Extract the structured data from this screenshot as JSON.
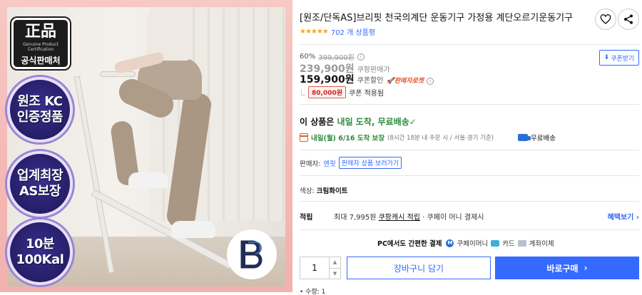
{
  "image": {
    "badge_authentic": {
      "main": "正品",
      "sub_en": "Genuine Product Certification",
      "sub_ko": "공식판매처"
    },
    "seals": [
      {
        "line1": "원조 KC",
        "line2": "인증정품"
      },
      {
        "line1": "업계최장",
        "line2": "AS보장"
      },
      {
        "line1": "10분",
        "line2": "100Kal"
      }
    ],
    "brand_logo_icon": "bb-monogram-icon"
  },
  "product": {
    "title": "[원조/단독AS]브리핏 천국의계단 운동기구 가정용 계단오르기운동기구",
    "stars_display": "★★★★★",
    "rating": 5,
    "review_count": "702 개 상품평"
  },
  "pricing": {
    "discount_rate": "60%",
    "original_price": "399,900원",
    "sale_price": "239,900원",
    "sale_label": "쿠팡판매가",
    "coupon_price": "159,900원",
    "coupon_label": "쿠폰할인",
    "rocket_label": "판매자로켓",
    "coupon_amount": "80,000원",
    "coupon_applied_text": "쿠폰 적용됨",
    "coupon_download_label": "쿠폰받기"
  },
  "delivery": {
    "headline_prefix": "이 상품은 ",
    "headline_highlight": "내일 도착, 무료배송",
    "headline_check": "✓",
    "arrival_date": "내일(월) 6/16 도착 보장",
    "arrival_condition": "(8시간 18분 내 주문 시 / 서울⋅경기 기준)",
    "shipping_fee": "무료배송"
  },
  "seller": {
    "label": "판매자:",
    "name": "엔핏",
    "link_label": "판매자 상품 보러가기"
  },
  "option": {
    "label": "색상:",
    "value": "크림화이트"
  },
  "reward": {
    "label": "적립",
    "max_amount": "최대 7,995원",
    "cash_label": "쿠팡캐시 적립",
    "tail": "· 쿠페이 머니 결제시",
    "benefit_link": "혜택보기"
  },
  "payment": {
    "lead": "PC에서도 간편한 결제",
    "methods": [
      "쿠페이머니",
      "카드",
      "계좌이체"
    ]
  },
  "purchase": {
    "quantity": "1",
    "cart_label": "장바구니 담기",
    "buy_label": "바로구매",
    "buy_arrow": "›",
    "qty_footnote": "• 수량: 1"
  },
  "colors": {
    "accent": "#346aff",
    "star": "#f5a623",
    "delivery_green": "#2f8a3b",
    "coupon_red": "#c22"
  }
}
